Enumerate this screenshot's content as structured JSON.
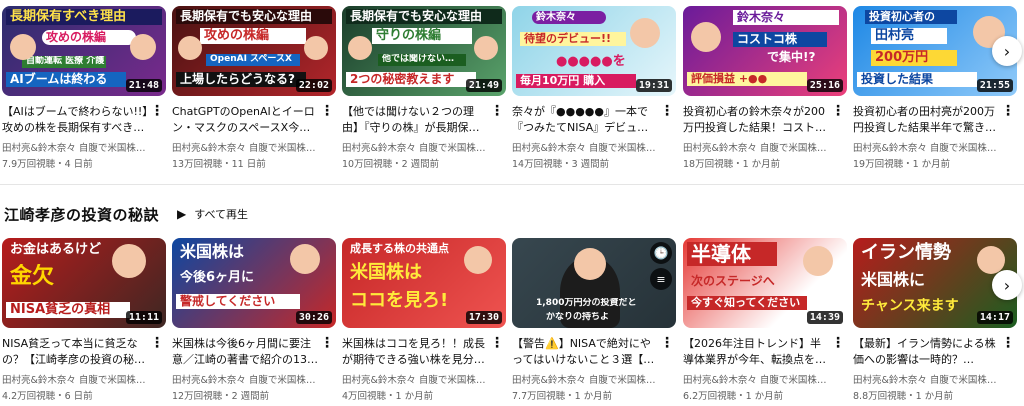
{
  "shelf1": {
    "videos": [
      {
        "title": "【AIはブームで終わらない!!】攻めの株を長期保有すべき…",
        "channel": "田村亮&鈴木奈々 自腹で米国株はじ…",
        "stats": "7.9万回視聴・4 日前",
        "duration": "21:48",
        "thumb_lines": [
          "長期保有すべき理由",
          "攻めの株編",
          "自動運転 医療 介護",
          "AIブームは終わる"
        ]
      },
      {
        "title": "ChatGPTのOpenAIとイーロン・マスクのスペースX今年…",
        "channel": "田村亮&鈴木奈々 自腹で米国株はじ…",
        "stats": "13万回視聴・11 日前",
        "duration": "22:02",
        "thumb_lines": [
          "長期保有でも安心な理由",
          "攻めの株編",
          "OpenAI スペースX",
          "上場したらどうなる?"
        ]
      },
      {
        "title": "【他では聞けない２つの理由】『守りの株』が長期保有…",
        "channel": "田村亮&鈴木奈々 自腹で米国株はじ…",
        "stats": "10万回視聴・2 週間前",
        "duration": "21:49",
        "thumb_lines": [
          "長期保有でも安心な理由",
          "守りの株編",
          "他では聞けない…",
          "2つの秘密教えます"
        ]
      },
      {
        "title": "奈々が『●●●●●』一本で『つみたてNISA』デビュ…",
        "channel": "田村亮&鈴木奈々 自腹で米国株はじ…",
        "stats": "14万回視聴・3 週間前",
        "duration": "19:31",
        "thumb_lines": [
          "鈴木奈々",
          "待望のデビュー!!",
          "●●●●●を",
          "毎月10万円 購入"
        ]
      },
      {
        "title": "投資初心者の鈴木奈々が200万円投資した結果！コスト…",
        "channel": "田村亮&鈴木奈々 自腹で米国株はじ…",
        "stats": "18万回視聴・1 か月前",
        "duration": "25:16",
        "thumb_lines": [
          "鈴木奈々",
          "コストコ株",
          "で集中!?",
          "評価損益 +●●"
        ]
      },
      {
        "title": "投資初心者の田村亮が200万円投資した結果半年で驚き…",
        "channel": "田村亮&鈴木奈々 自腹で米国株はじ…",
        "stats": "19万回視聴・1 か月前",
        "duration": "21:55",
        "thumb_lines": [
          "投資初心者の",
          "田村亮",
          "200万円",
          "投資した結果"
        ]
      }
    ]
  },
  "shelf2": {
    "title": "江崎孝彦の投資の秘訣",
    "play_all_label": "すべて再生",
    "videos": [
      {
        "title": "NISA貧乏って本当に貧乏なの？【江崎孝彦の投資の秘…",
        "channel": "田村亮&鈴木奈々 自腹で米国株はじ…",
        "stats": "4.2万回視聴・6 日前",
        "duration": "11:11",
        "thumb_lines": [
          "お金はあるけど",
          "金欠",
          "NISA貧乏の真相"
        ]
      },
      {
        "title": "米国株は今後6ヶ月間に要注意／江崎の著書で紹介の13…",
        "channel": "田村亮&鈴木奈々 自腹で米国株はじ…",
        "stats": "12万回視聴・2 週間前",
        "duration": "30:26",
        "thumb_lines": [
          "米国株は",
          "今後6ヶ月に",
          "警戒してください"
        ]
      },
      {
        "title": "米国株はココを見ろ！！成長が期待できる強い株を見分…",
        "channel": "田村亮&鈴木奈々 自腹で米国株はじ…",
        "stats": "4万回視聴・1 か月前",
        "duration": "17:30",
        "thumb_lines": [
          "成長する株の共通点",
          "米国株は",
          "ココを見ろ!"
        ]
      },
      {
        "title": "【警告⚠️】NISAで絶対にやってはいけないこと３選【…",
        "channel": "田村亮&鈴木奈々 自腹で米国株はじ…",
        "stats": "7.7万回視聴・1 か月前",
        "duration": "",
        "thumb_lines": [
          "1,800万円分の投資だと",
          "かなりの持ちよ"
        ]
      },
      {
        "title": "【2026年注目トレンド】半導体業界が今年、転換点を迎…",
        "channel": "田村亮&鈴木奈々 自腹で米国株はじ…",
        "stats": "6.2万回視聴・1 か月前",
        "duration": "14:39",
        "thumb_lines": [
          "半導体",
          "次のステージへ",
          "今すぐ知ってください"
        ]
      },
      {
        "title": "【最新】イラン情勢による株価への影響は一時的？2026…",
        "channel": "田村亮&鈴木奈々 自腹で米国株はじ…",
        "stats": "8.8万回視聴・1 か月前",
        "duration": "14:17",
        "thumb_lines": [
          "イラン情勢",
          "米国株に",
          "チャンス来ます"
        ]
      }
    ]
  },
  "icons": {
    "kebab": "more-vert-icon",
    "next": "chevron-right-icon",
    "play": "play-icon",
    "clock": "watch-later-icon",
    "queue": "add-to-queue-icon"
  },
  "glyphs": {
    "kebab": "⋮",
    "next": "›",
    "play": "▶",
    "clock": "🕒",
    "queue": "≡"
  }
}
